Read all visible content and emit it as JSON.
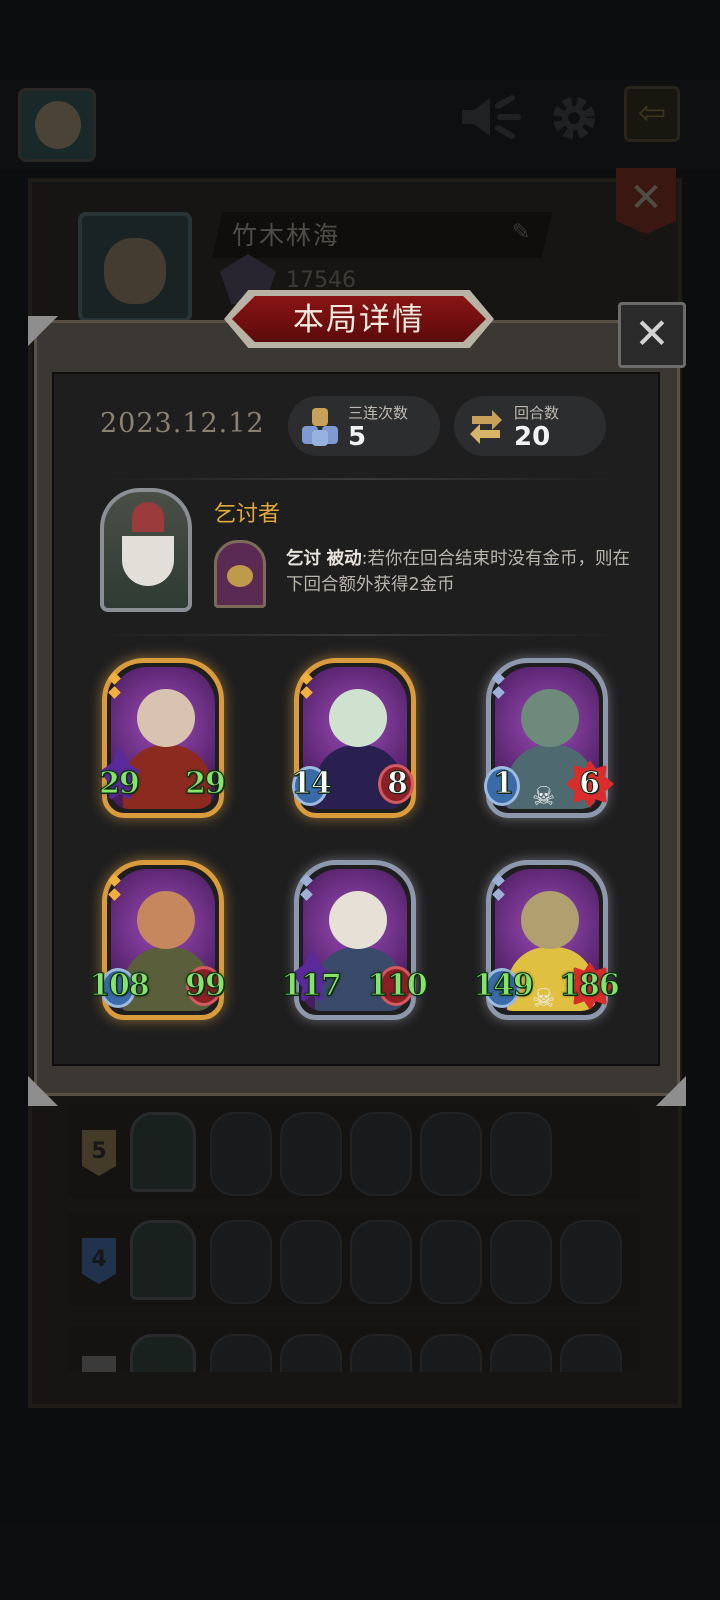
{
  "background": {
    "player_name": "竹木林海",
    "score": "17546",
    "lineup_rows": [
      {
        "level": "5",
        "badge_color": "#7a6a4a"
      },
      {
        "level": "4",
        "badge_color": "#3c5c8a"
      },
      {
        "level": "",
        "badge_color": "#6a6a6a"
      }
    ]
  },
  "icons": {
    "speaker": "speaker-icon",
    "settings": "gear-icon",
    "back": "back-arrow-icon",
    "close": "close-icon",
    "edit": "pencil-icon"
  },
  "modal": {
    "title": "本局详情",
    "close_label": "✕",
    "date": "2023.12.12",
    "triples_label": "三连次数",
    "triples_value": "5",
    "rounds_label": "回合数",
    "rounds_value": "20"
  },
  "hero": {
    "name": "乞讨者",
    "skill_name": "乞讨",
    "skill_type": "被动",
    "skill_desc": ":若你在回合结束时没有金币，则在下回合额外获得2金币"
  },
  "units": [
    {
      "attack": "29",
      "health": "29",
      "frame": "gold",
      "attack_style": "purple",
      "health_style": "plain",
      "color": "green",
      "skull": false
    },
    {
      "attack": "14",
      "health": "8",
      "frame": "gold",
      "attack_style": "blue",
      "health_style": "red",
      "color": "white",
      "skull": false
    },
    {
      "attack": "1",
      "health": "6",
      "frame": "silver",
      "attack_style": "blue",
      "health_style": "spike",
      "color": "white",
      "skull": true
    },
    {
      "attack": "108",
      "health": "99",
      "frame": "gold",
      "attack_style": "blue",
      "health_style": "red",
      "color": "green",
      "skull": false
    },
    {
      "attack": "117",
      "health": "110",
      "frame": "silver",
      "attack_style": "purple",
      "health_style": "red",
      "color": "green",
      "skull": false
    },
    {
      "attack": "149",
      "health": "186",
      "frame": "silver",
      "attack_style": "blue",
      "health_style": "spike",
      "color": "green",
      "skull": true
    }
  ]
}
